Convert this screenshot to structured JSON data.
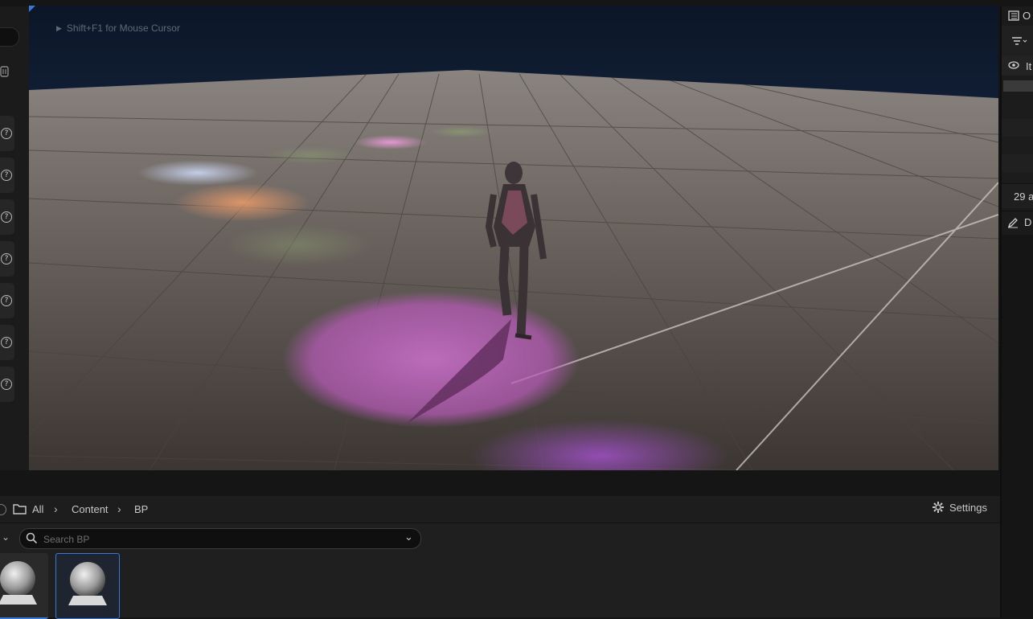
{
  "viewport": {
    "hint_text": "Shift+F1 for Mouse Cursor"
  },
  "left_panel": {
    "help_buttons": [
      "?",
      "?",
      "?",
      "?",
      "?",
      "?",
      "?"
    ]
  },
  "content_browser": {
    "breadcrumb": [
      "All",
      "Content",
      "BP"
    ],
    "settings_label": "Settings",
    "search_placeholder": "Search BP",
    "assets": [
      {
        "label": "",
        "selected": false
      },
      {
        "label": "",
        "selected": true
      }
    ]
  },
  "right_panel": {
    "outliner_title_clip": "O",
    "item_label_clip": "It",
    "count_clip": "29 a",
    "details_title_clip": "D"
  },
  "colors": {
    "accent": "#3a78d6",
    "selected_border": "#3a78d6",
    "panel_bg": "#1f1f1f",
    "sky_top": "#0e1a2e",
    "floor": "#6a625c"
  },
  "icons": {
    "folder": "folder-icon",
    "search": "search-icon",
    "settings": "gear-icon",
    "help": "help-icon",
    "eye": "eye-icon",
    "filter": "filter-icon",
    "outliner": "outliner-icon",
    "details": "pencil-icon"
  }
}
